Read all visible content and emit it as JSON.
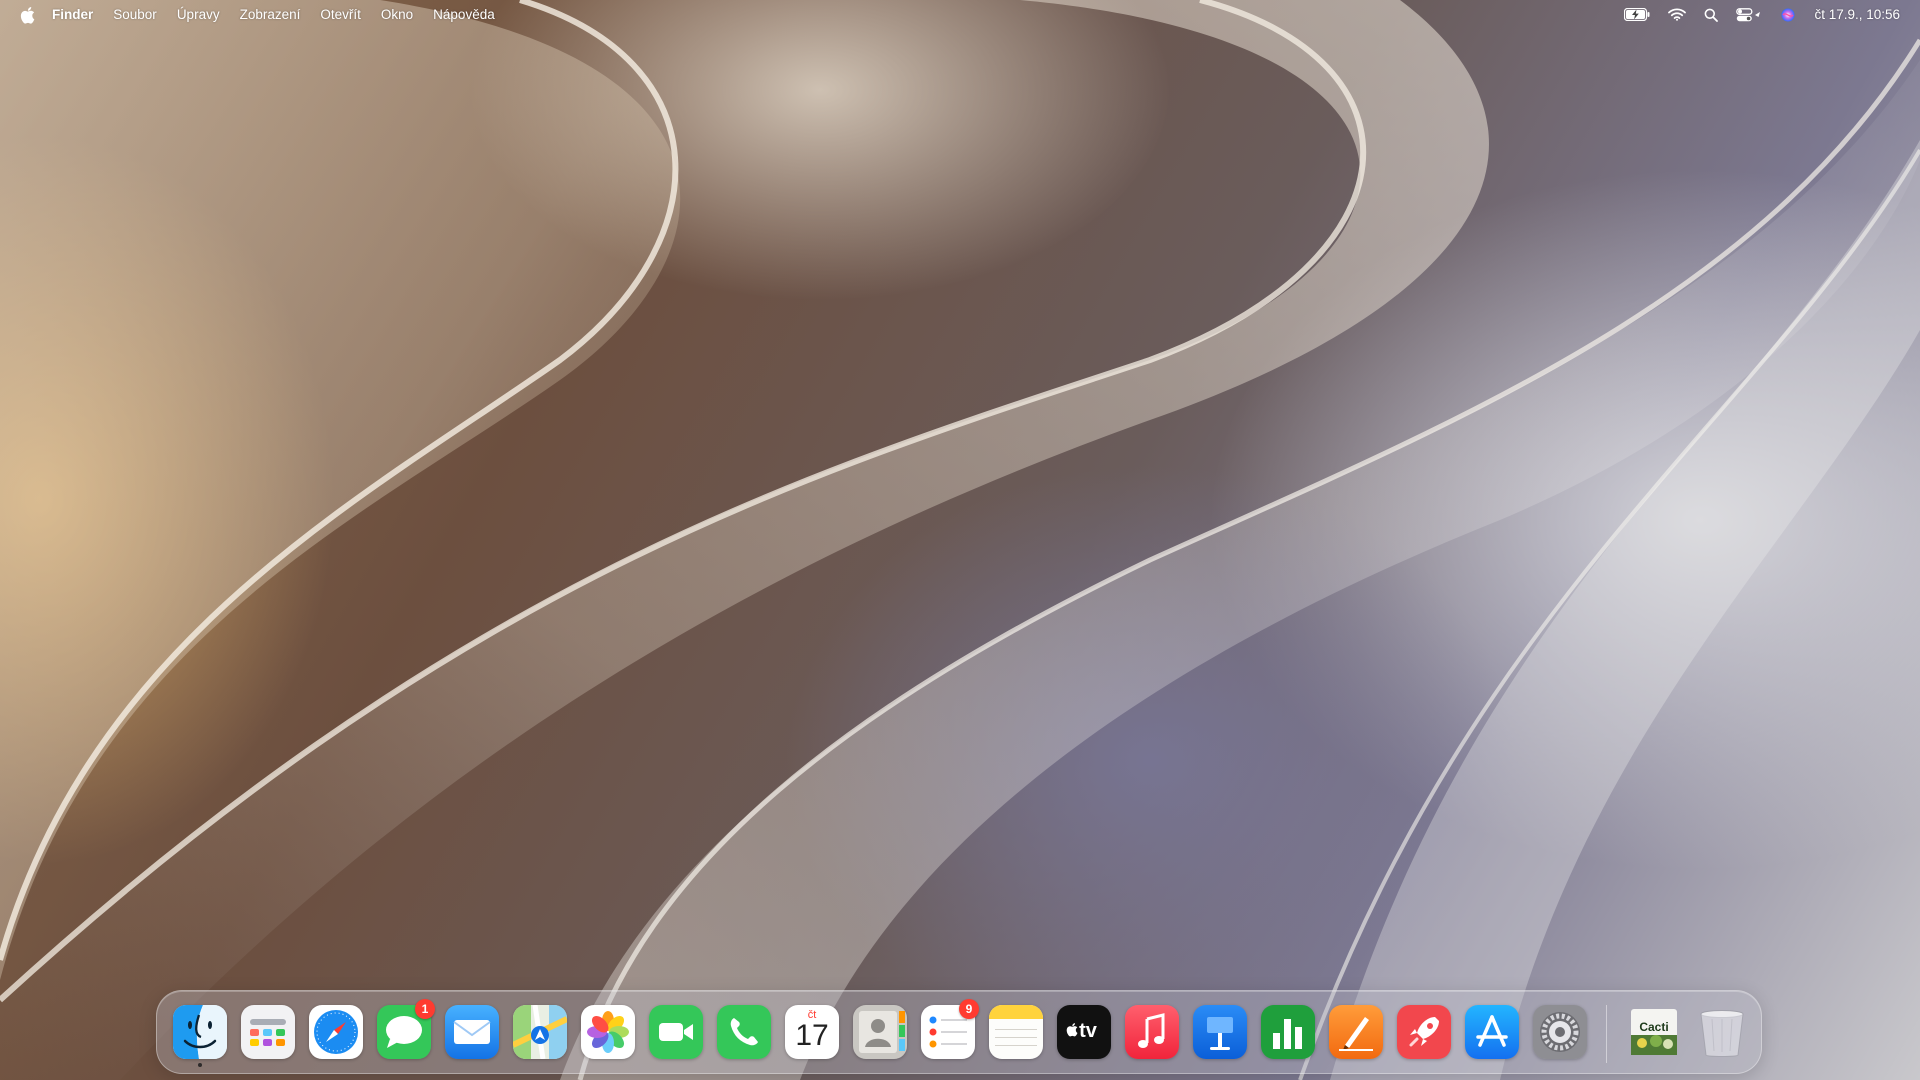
{
  "menubar": {
    "app_name": "Finder",
    "items": [
      "Soubor",
      "Úpravy",
      "Zobrazení",
      "Otevřít",
      "Okno",
      "Nápověda"
    ],
    "clock": "čt 17.9., 10:56",
    "status_icons": [
      "battery-charging-icon",
      "wifi-icon",
      "spotlight-search-icon",
      "control-center-icon",
      "siri-icon"
    ]
  },
  "dock": {
    "apps": [
      {
        "name": "Finder",
        "icon": "finder-icon",
        "running": true
      },
      {
        "name": "Launchpad",
        "icon": "launchpad-icon"
      },
      {
        "name": "Safari",
        "icon": "safari-icon"
      },
      {
        "name": "Zprávy",
        "icon": "messages-icon",
        "badge": "1"
      },
      {
        "name": "Mail",
        "icon": "mail-icon"
      },
      {
        "name": "Mapy",
        "icon": "maps-icon"
      },
      {
        "name": "Fotky",
        "icon": "photos-icon"
      },
      {
        "name": "FaceTime",
        "icon": "facetime-icon"
      },
      {
        "name": "Telefon",
        "icon": "phone-icon"
      },
      {
        "name": "Kalendář",
        "icon": "calendar-icon",
        "day": "čt",
        "date": "17"
      },
      {
        "name": "Kontakty",
        "icon": "contacts-icon"
      },
      {
        "name": "Připomínky",
        "icon": "reminders-icon",
        "badge": "9"
      },
      {
        "name": "Poznámky",
        "icon": "notes-icon"
      },
      {
        "name": "TV",
        "icon": "apple-tv-icon",
        "label": "tv"
      },
      {
        "name": "Hudba",
        "icon": "music-icon"
      },
      {
        "name": "Keynote",
        "icon": "keynote-icon"
      },
      {
        "name": "Numbers",
        "icon": "numbers-icon"
      },
      {
        "name": "Pages",
        "icon": "pages-icon"
      },
      {
        "name": "RocketSim",
        "icon": "rocket-icon"
      },
      {
        "name": "App Store",
        "icon": "app-store-icon"
      },
      {
        "name": "Nastavení systému",
        "icon": "system-settings-icon"
      }
    ],
    "stack": {
      "name": "Cacti",
      "icon": "cacti-folder-icon",
      "label": "Cacti"
    },
    "trash": {
      "name": "Koš",
      "icon": "trash-icon"
    }
  },
  "colors": {
    "badge": "#ff3b30",
    "menubar_text": "#ffffff"
  }
}
